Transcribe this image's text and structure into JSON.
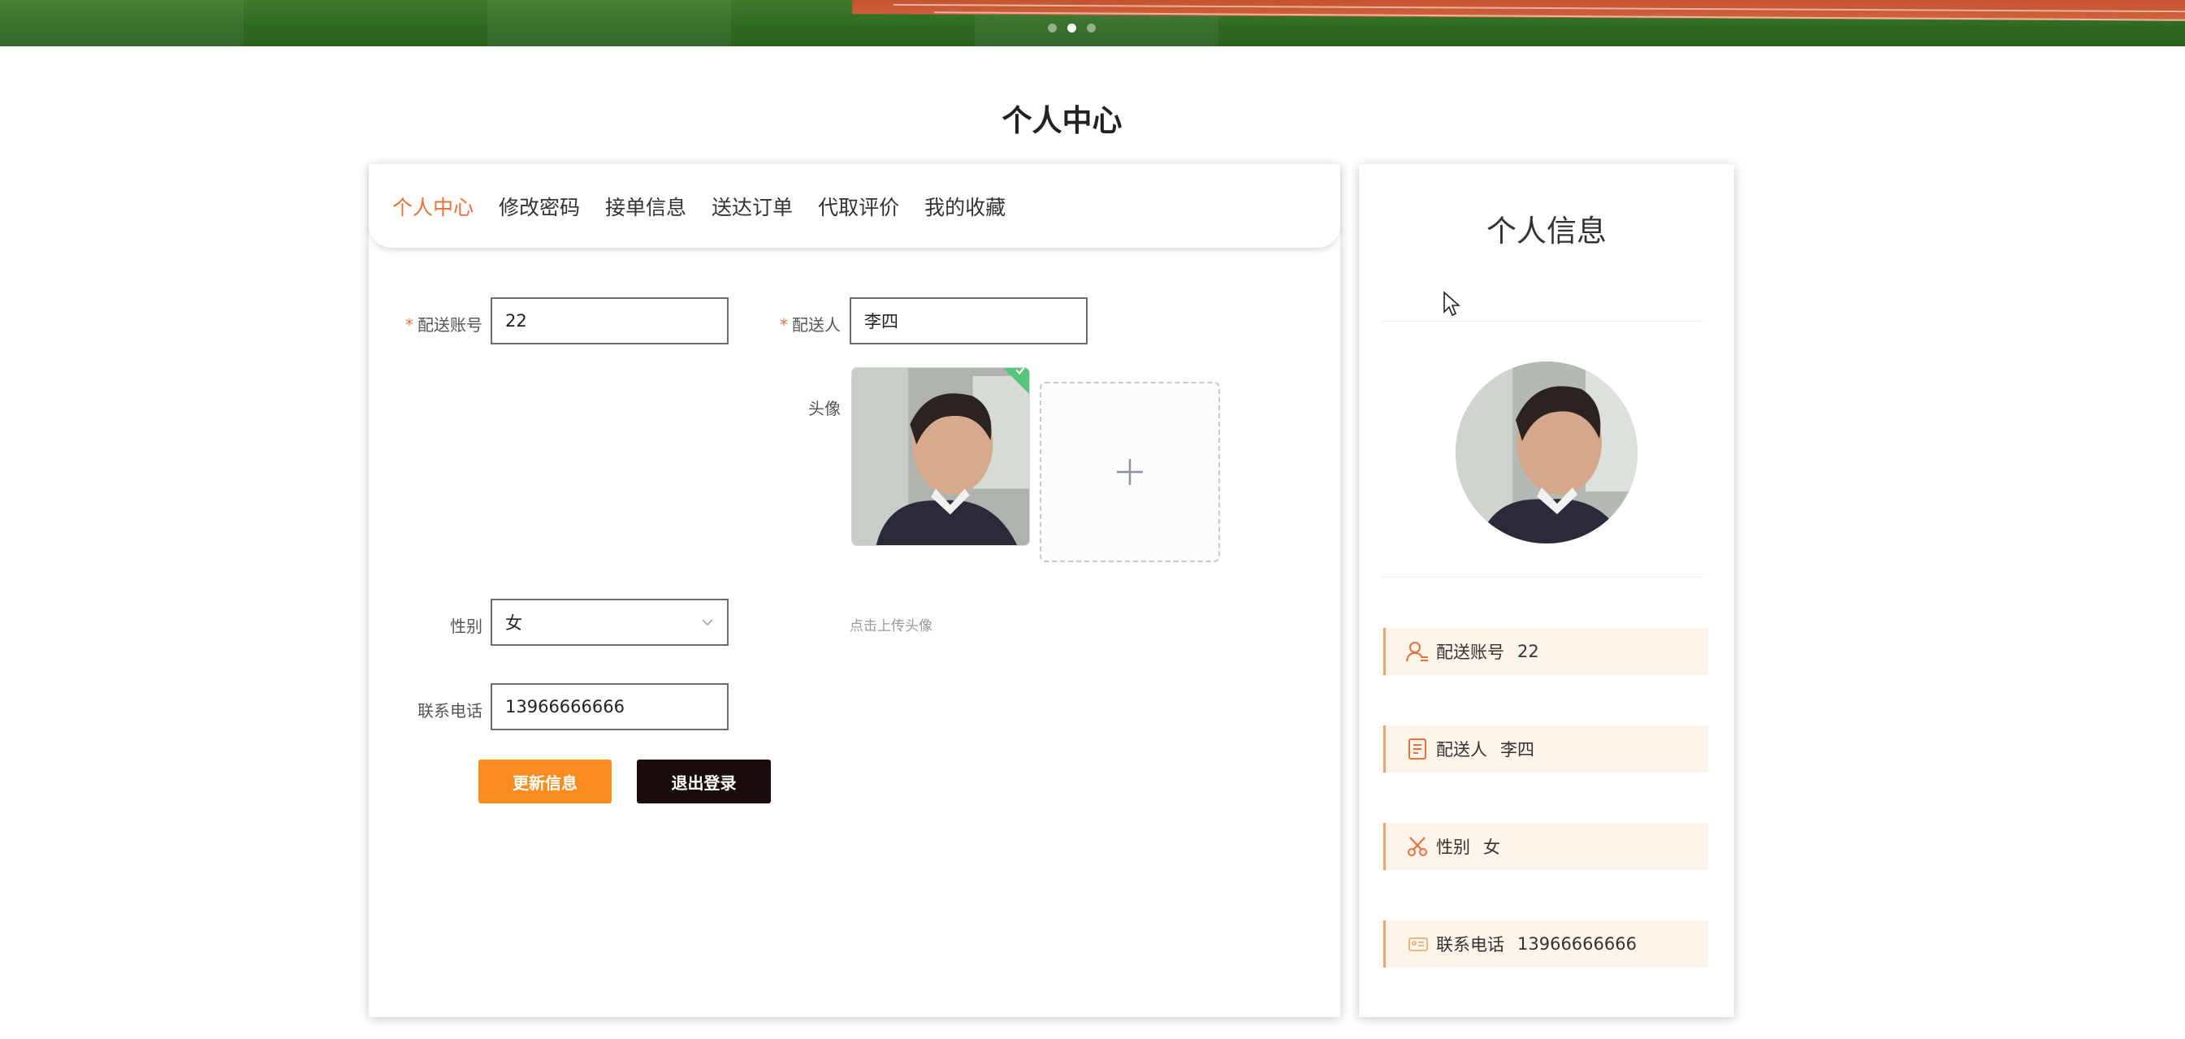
{
  "colors": {
    "accent": "#e9703a",
    "update_button": "#fb8c20",
    "logout_button": "#1a0c0a",
    "info_row_background": "#fef4ea"
  },
  "banner": {
    "dot_count": 3,
    "active_dot": 1
  },
  "page": {
    "title": "个人中心"
  },
  "tabs": [
    {
      "label": "个人中心",
      "active": true
    },
    {
      "label": "修改密码",
      "active": false
    },
    {
      "label": "接单信息",
      "active": false
    },
    {
      "label": "送达订单",
      "active": false
    },
    {
      "label": "代取评价",
      "active": false
    },
    {
      "label": "我的收藏",
      "active": false
    }
  ],
  "form": {
    "account": {
      "label": "配送账号",
      "required_mark": "*",
      "value": "22"
    },
    "courier": {
      "label": "配送人",
      "required_mark": "*",
      "value": "李四"
    },
    "avatar": {
      "label": "头像",
      "hint": "点击上传头像",
      "upload_icon": "plus-icon",
      "status_icon": "check-icon"
    },
    "gender": {
      "label": "性别",
      "value": "女",
      "icon": "chevron-down-icon"
    },
    "phone": {
      "label": "联系电话",
      "value": "13966666666"
    },
    "update_button": "更新信息",
    "logout_button": "退出登录"
  },
  "profile": {
    "title": "个人信息",
    "rows": [
      {
        "icon": "user-id-icon",
        "label": "配送账号",
        "value": "22"
      },
      {
        "icon": "document-icon",
        "label": "配送人",
        "value": "李四"
      },
      {
        "icon": "scissors-icon",
        "label": "性别",
        "value": "女"
      },
      {
        "icon": "id-card-icon",
        "label": "联系电话",
        "value": "13966666666"
      }
    ]
  }
}
